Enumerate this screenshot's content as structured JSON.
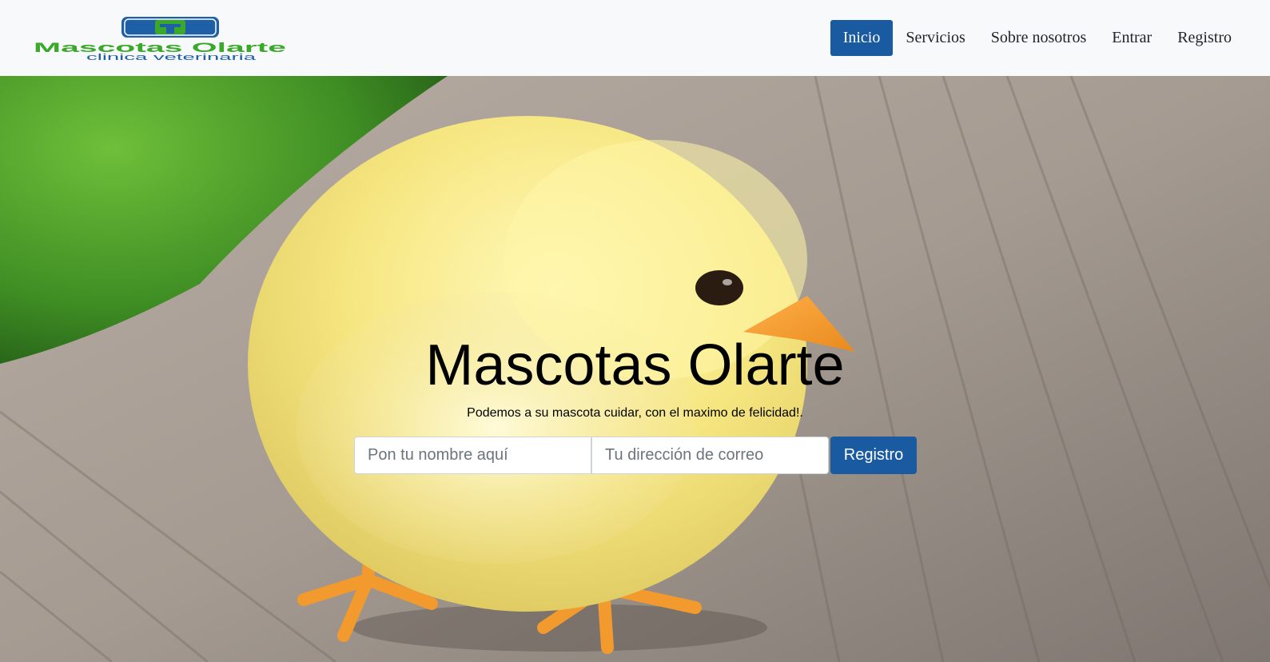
{
  "brand": {
    "logo_text": "Mascotas Olarte",
    "logo_tagline": "clinica veterinaria",
    "colors": {
      "green": "#3aa829",
      "blue": "#1f5fa8"
    }
  },
  "nav": {
    "items": [
      {
        "label": "Inicio",
        "active": true
      },
      {
        "label": "Servicios",
        "active": false
      },
      {
        "label": "Sobre nosotros",
        "active": false
      },
      {
        "label": "Entrar",
        "active": false
      },
      {
        "label": "Registro",
        "active": false
      }
    ],
    "accent": "#1a5aa0"
  },
  "hero": {
    "title": "Mascotas Olarte",
    "subtitle": "Podemos a su mascota cuidar, con el maximo de felicidad!.",
    "name_placeholder": "Pon tu nombre aquí",
    "email_placeholder": "Tu dirección de correo",
    "submit_label": "Registro"
  }
}
